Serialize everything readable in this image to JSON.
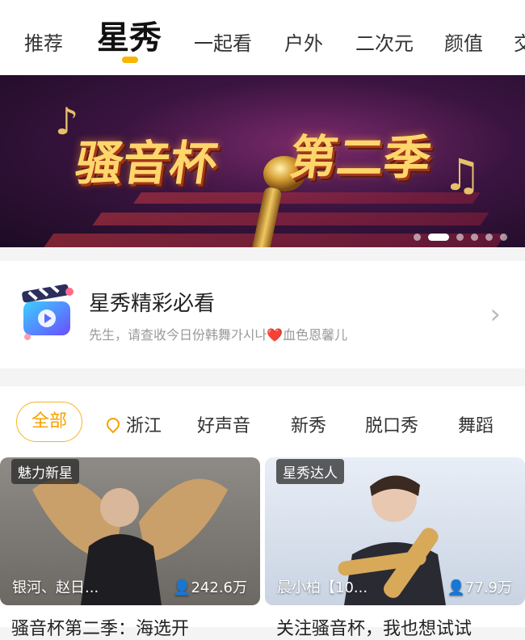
{
  "tabs": [
    "推荐",
    "星秀",
    "一起看",
    "户外",
    "二次元",
    "颜值",
    "交"
  ],
  "active_tab_index": 1,
  "banner": {
    "title_left": "骚音杯",
    "title_right": "第二季",
    "dots": 6,
    "active_dot_index": 1
  },
  "highlight": {
    "title": "星秀精彩必看",
    "subtitle": "先生，请查收今日份韩舞가시나❤️血色恩馨儿",
    "icon": "clapperboard-icon"
  },
  "filters": [
    {
      "label": "全部",
      "active": true
    },
    {
      "label": "浙江",
      "icon": "location-pin-icon"
    },
    {
      "label": "好声音"
    },
    {
      "label": "新秀"
    },
    {
      "label": "脱口秀"
    },
    {
      "label": "舞蹈"
    }
  ],
  "cards": [
    {
      "tag": "魅力新星",
      "name": "银河、赵日...",
      "views": "242.6万",
      "caption": "骚音杯第二季：海选开"
    },
    {
      "tag": "星秀达人",
      "name": "晨小柏【10...",
      "views": "77.9万",
      "caption": "关注骚音杯，我也想试试"
    }
  ],
  "colors": {
    "accent": "#f5a100"
  }
}
